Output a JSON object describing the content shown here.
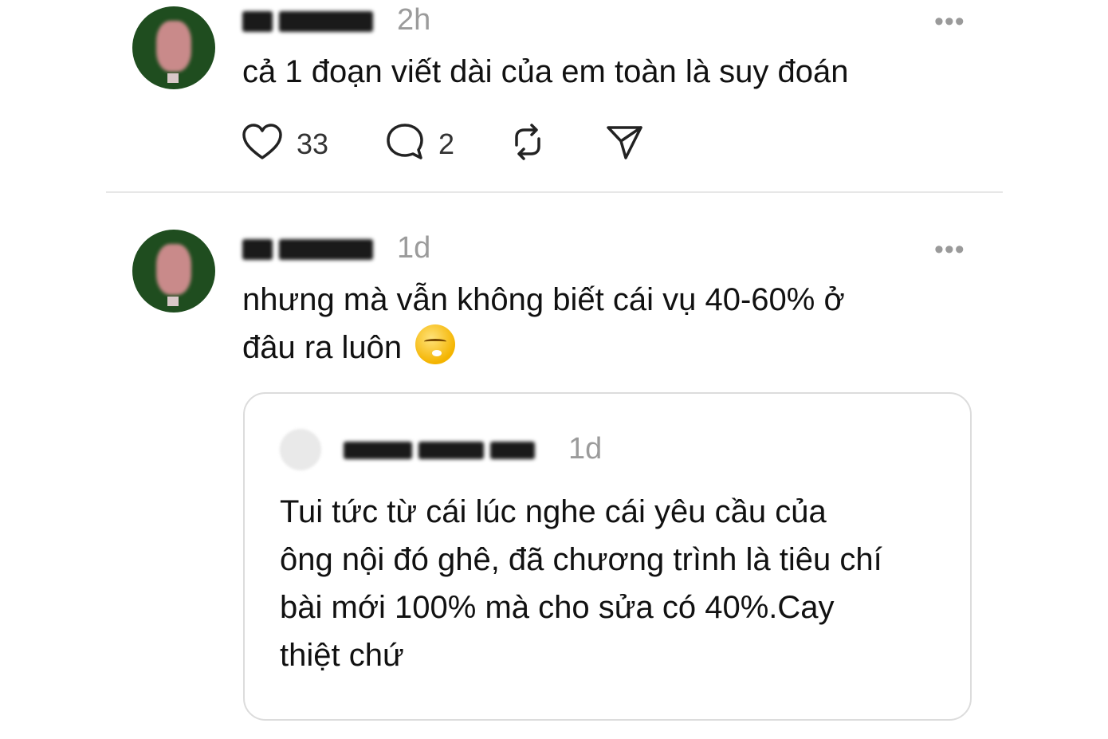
{
  "posts": [
    {
      "username": "M J***",
      "time": "2h",
      "more": "•••",
      "text": "cả 1 đoạn viết dài của em toàn là suy đoán",
      "likes": "33",
      "replies": "2"
    },
    {
      "username": "M J***",
      "time": "1d",
      "more": "•••",
      "text_line1": "nhưng mà vẫn không biết cái vụ 40-60% ở",
      "text_line2": "đâu ra luôn",
      "emoji": "weary-face-emoji",
      "quote": {
        "username": "J***",
        "time": "1d",
        "lines": [
          "Tui tức từ cái lúc nghe cái yêu cầu của",
          "ông nội đó ghê, đã chương trình là tiêu chí",
          "bài mới 100% mà cho sửa có 40%.Cay",
          "thiệt chứ"
        ]
      }
    }
  ],
  "icons": {
    "like": "heart-icon",
    "reply": "comment-icon",
    "repost": "repost-icon",
    "share": "send-icon"
  }
}
